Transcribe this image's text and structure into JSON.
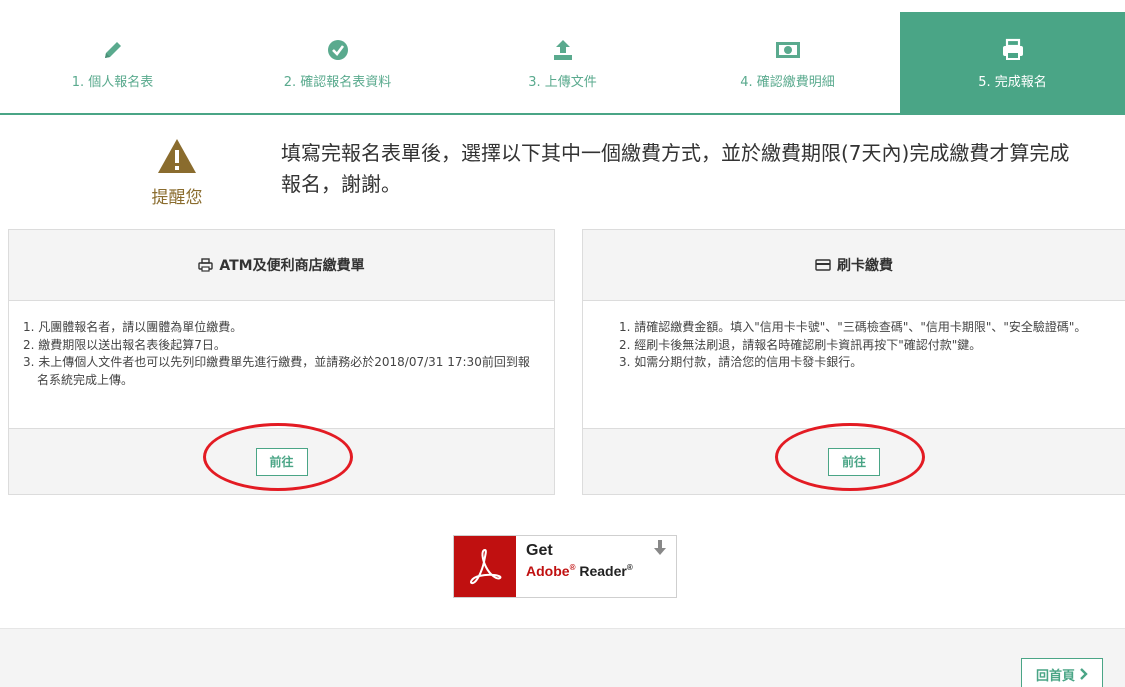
{
  "steps": [
    {
      "label": "1. 個人報名表",
      "icon": "pencil-icon"
    },
    {
      "label": "2. 確認報名表資料",
      "icon": "check-circle-icon"
    },
    {
      "label": "3. 上傳文件",
      "icon": "upload-icon"
    },
    {
      "label": "4. 確認繳費明細",
      "icon": "money-icon"
    },
    {
      "label": "5. 完成報名",
      "icon": "printer-icon"
    }
  ],
  "active_step": 5,
  "reminder": {
    "label": "提醒您",
    "icon": "warning-icon",
    "text": "填寫完報名表單後，選擇以下其中一個繳費方式，並於繳費期限(7天內)完成繳費才算完成報名，謝謝。"
  },
  "atm_panel": {
    "title": "ATM及便利商店繳費單",
    "icon": "printer-icon",
    "items": [
      "1. 凡團體報名者，請以團體為單位繳費。",
      "2. 繳費期限以送出報名表後起算7日。",
      "3. 未上傳個人文件者也可以先列印繳費單先進行繳費，並請務必於2018/07/31 17:30前回到報名系統完成上傳。"
    ],
    "button": "前往"
  },
  "card_panel": {
    "title": "刷卡繳費",
    "icon": "credit-card-icon",
    "items": [
      "1. 請確認繳費金額。填入\"信用卡卡號\"、\"三碼檢查碼\"、\"信用卡期限\"、\"安全驗證碼\"。",
      "2. 經刷卡後無法刷退，請報名時確認刷卡資訊再按下\"確認付款\"鍵。",
      "3. 如需分期付款，請洽您的信用卡發卡銀行。"
    ],
    "button": "前往"
  },
  "adobe": {
    "get": "Get",
    "brand": "Adobe",
    "product": "Reader"
  },
  "footer": {
    "home_button": "回首頁"
  },
  "colors": {
    "accent": "#4aa586",
    "highlight_ring": "#e31b23",
    "warning": "#8a6c2e",
    "adobe_red": "#c01010"
  }
}
